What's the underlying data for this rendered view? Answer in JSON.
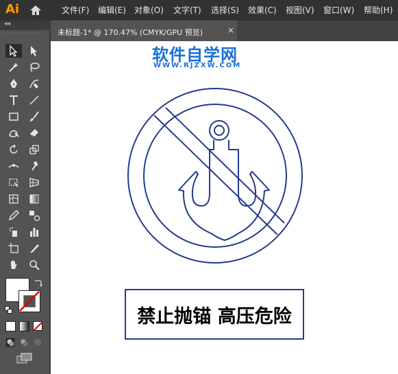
{
  "app": {
    "logo": "Ai"
  },
  "menu": [
    "文件(F)",
    "编辑(E)",
    "对象(O)",
    "文字(T)",
    "选择(S)",
    "效果(C)",
    "视图(V)",
    "窗口(W)",
    "帮助(H)"
  ],
  "tab": {
    "title": "未标题-1* @ 170.47% (CMYK/GPU 预览)",
    "close": "×"
  },
  "toolbar": {
    "collapse": "◂◂"
  },
  "watermark": {
    "title": "软件自学网",
    "url": "WWW.RJZXW.COM"
  },
  "sign": {
    "text": "禁止抛锚 高压危险"
  },
  "colors": {
    "accent": "#ff9a00",
    "sign_stroke": "#253a8c",
    "watermark": "#1a6fd8"
  },
  "icons": [
    "selection-icon",
    "direct-selection-icon",
    "magic-wand-icon",
    "lasso-icon",
    "pen-icon",
    "curvature-icon",
    "type-icon",
    "line-icon",
    "rectangle-icon",
    "paintbrush-icon",
    "shaper-icon",
    "eraser-icon",
    "rotate-icon",
    "scale-icon",
    "width-icon",
    "puppet-warp-icon",
    "free-transform-icon",
    "perspective-icon",
    "mesh-icon",
    "gradient-icon",
    "eyedropper-icon",
    "blend-icon",
    "symbol-sprayer-icon",
    "column-graph-icon",
    "artboard-icon",
    "slice-icon",
    "hand-icon",
    "zoom-icon"
  ]
}
